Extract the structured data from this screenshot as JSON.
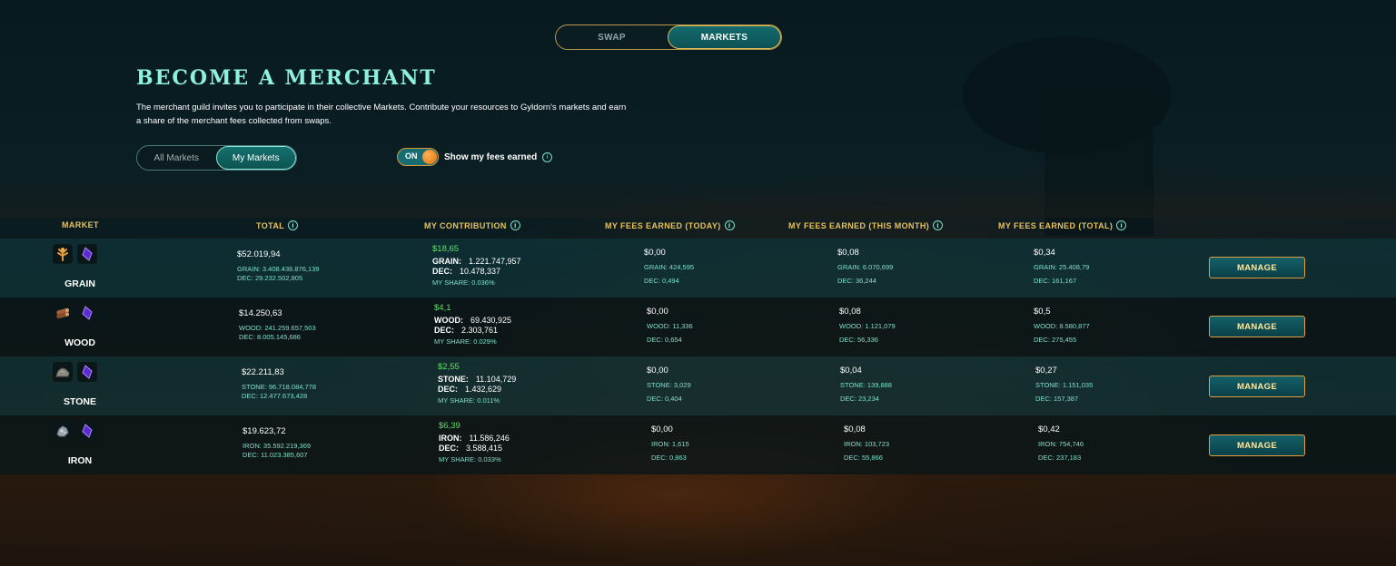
{
  "tabs": {
    "swap": "SWAP",
    "markets": "MARKETS"
  },
  "title": "BECOME A MERCHANT",
  "description": "The merchant guild invites you to participate in their collective Markets. Contribute your resources to Gyldorn's markets and earn a share of the merchant fees collected from swaps.",
  "filters": {
    "all": "All Markets",
    "mine": "My Markets"
  },
  "toggle": {
    "state": "ON",
    "label": "Show my fees earned"
  },
  "columns": {
    "market": "MARKET",
    "total": "TOTAL",
    "contribution": "MY CONTRIBUTION",
    "fees_today": "MY FEES EARNED (TODAY)",
    "fees_month": "MY FEES EARNED (THIS MONTH)",
    "fees_total": "MY FEES EARNED (TOTAL)"
  },
  "info_glyph": "i",
  "manage_label": "MANAGE",
  "rows": [
    {
      "name": "GRAIN",
      "icon": "grain-icon",
      "total": "$52.019,94",
      "total_res": "GRAIN: 3.408.436.876,139",
      "total_dec": "DEC: 29.232.502,805",
      "contrib_usd": "$18,65",
      "contrib_res_label": "GRAIN:",
      "contrib_res": "1.221.747,957",
      "contrib_dec_label": "DEC:",
      "contrib_dec": "10.478,337",
      "share": "MY SHARE: 0.036%",
      "today": "$0,00",
      "today_res": "GRAIN: 424,595",
      "today_dec": "DEC: 0,494",
      "month": "$0,08",
      "month_res": "GRAIN: 6.070,699",
      "month_dec": "DEC: 36,244",
      "alltime": "$0,34",
      "alltime_res": "GRAIN: 25.408,79",
      "alltime_dec": "DEC: 161,167"
    },
    {
      "name": "WOOD",
      "icon": "wood-icon",
      "total": "$14.250,63",
      "total_res": "WOOD: 241.259.657,503",
      "total_dec": "DEC: 8.005.145,686",
      "contrib_usd": "$4,1",
      "contrib_res_label": "WOOD:",
      "contrib_res": "69.430,925",
      "contrib_dec_label": "DEC:",
      "contrib_dec": "2.303,761",
      "share": "MY SHARE: 0.029%",
      "today": "$0,00",
      "today_res": "WOOD: 11,336",
      "today_dec": "DEC: 0,654",
      "month": "$0,08",
      "month_res": "WOOD: 1.121,079",
      "month_dec": "DEC: 56,336",
      "alltime": "$0,5",
      "alltime_res": "WOOD: 8.580,877",
      "alltime_dec": "DEC: 275,455"
    },
    {
      "name": "STONE",
      "icon": "stone-icon",
      "total": "$22.211,83",
      "total_res": "STONE: 96.718.084,778",
      "total_dec": "DEC: 12.477.673,428",
      "contrib_usd": "$2,55",
      "contrib_res_label": "STONE:",
      "contrib_res": "11.104,729",
      "contrib_dec_label": "DEC:",
      "contrib_dec": "1.432,629",
      "share": "MY SHARE: 0.011%",
      "today": "$0,00",
      "today_res": "STONE: 3,029",
      "today_dec": "DEC: 0,404",
      "month": "$0,04",
      "month_res": "STONE: 139,888",
      "month_dec": "DEC: 23,234",
      "alltime": "$0,27",
      "alltime_res": "STONE: 1.151,035",
      "alltime_dec": "DEC: 157,387"
    },
    {
      "name": "IRON",
      "icon": "iron-icon",
      "total": "$19.623,72",
      "total_res": "IRON: 35.592.219,369",
      "total_dec": "DEC: 11.023.385,607",
      "contrib_usd": "$6,39",
      "contrib_res_label": "IRON:",
      "contrib_res": "11.586,246",
      "contrib_dec_label": "DEC:",
      "contrib_dec": "3.588,415",
      "share": "MY SHARE: 0.033%",
      "today": "$0,00",
      "today_res": "IRON: 1,615",
      "today_dec": "DEC: 0,863",
      "month": "$0,08",
      "month_res": "IRON: 103,723",
      "month_dec": "DEC: 55,866",
      "alltime": "$0,42",
      "alltime_res": "IRON: 754,746",
      "alltime_dec": "DEC: 237,183"
    }
  ],
  "colors": {
    "accent": "#8ff0de",
    "gold": "#e7c25c",
    "positive": "#5fe06a",
    "button": "#136068"
  }
}
